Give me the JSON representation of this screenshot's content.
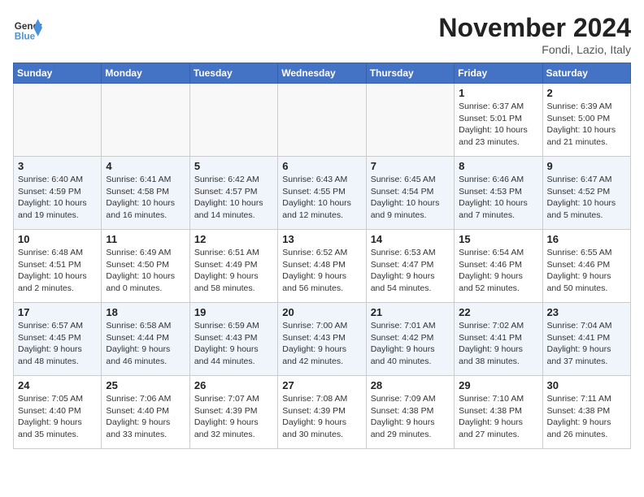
{
  "logo": {
    "line1": "General",
    "line2": "Blue"
  },
  "title": "November 2024",
  "subtitle": "Fondi, Lazio, Italy",
  "weekdays": [
    "Sunday",
    "Monday",
    "Tuesday",
    "Wednesday",
    "Thursday",
    "Friday",
    "Saturday"
  ],
  "weeks": [
    [
      {
        "day": "",
        "info": ""
      },
      {
        "day": "",
        "info": ""
      },
      {
        "day": "",
        "info": ""
      },
      {
        "day": "",
        "info": ""
      },
      {
        "day": "",
        "info": ""
      },
      {
        "day": "1",
        "info": "Sunrise: 6:37 AM\nSunset: 5:01 PM\nDaylight: 10 hours\nand 23 minutes."
      },
      {
        "day": "2",
        "info": "Sunrise: 6:39 AM\nSunset: 5:00 PM\nDaylight: 10 hours\nand 21 minutes."
      }
    ],
    [
      {
        "day": "3",
        "info": "Sunrise: 6:40 AM\nSunset: 4:59 PM\nDaylight: 10 hours\nand 19 minutes."
      },
      {
        "day": "4",
        "info": "Sunrise: 6:41 AM\nSunset: 4:58 PM\nDaylight: 10 hours\nand 16 minutes."
      },
      {
        "day": "5",
        "info": "Sunrise: 6:42 AM\nSunset: 4:57 PM\nDaylight: 10 hours\nand 14 minutes."
      },
      {
        "day": "6",
        "info": "Sunrise: 6:43 AM\nSunset: 4:55 PM\nDaylight: 10 hours\nand 12 minutes."
      },
      {
        "day": "7",
        "info": "Sunrise: 6:45 AM\nSunset: 4:54 PM\nDaylight: 10 hours\nand 9 minutes."
      },
      {
        "day": "8",
        "info": "Sunrise: 6:46 AM\nSunset: 4:53 PM\nDaylight: 10 hours\nand 7 minutes."
      },
      {
        "day": "9",
        "info": "Sunrise: 6:47 AM\nSunset: 4:52 PM\nDaylight: 10 hours\nand 5 minutes."
      }
    ],
    [
      {
        "day": "10",
        "info": "Sunrise: 6:48 AM\nSunset: 4:51 PM\nDaylight: 10 hours\nand 2 minutes."
      },
      {
        "day": "11",
        "info": "Sunrise: 6:49 AM\nSunset: 4:50 PM\nDaylight: 10 hours\nand 0 minutes."
      },
      {
        "day": "12",
        "info": "Sunrise: 6:51 AM\nSunset: 4:49 PM\nDaylight: 9 hours\nand 58 minutes."
      },
      {
        "day": "13",
        "info": "Sunrise: 6:52 AM\nSunset: 4:48 PM\nDaylight: 9 hours\nand 56 minutes."
      },
      {
        "day": "14",
        "info": "Sunrise: 6:53 AM\nSunset: 4:47 PM\nDaylight: 9 hours\nand 54 minutes."
      },
      {
        "day": "15",
        "info": "Sunrise: 6:54 AM\nSunset: 4:46 PM\nDaylight: 9 hours\nand 52 minutes."
      },
      {
        "day": "16",
        "info": "Sunrise: 6:55 AM\nSunset: 4:46 PM\nDaylight: 9 hours\nand 50 minutes."
      }
    ],
    [
      {
        "day": "17",
        "info": "Sunrise: 6:57 AM\nSunset: 4:45 PM\nDaylight: 9 hours\nand 48 minutes."
      },
      {
        "day": "18",
        "info": "Sunrise: 6:58 AM\nSunset: 4:44 PM\nDaylight: 9 hours\nand 46 minutes."
      },
      {
        "day": "19",
        "info": "Sunrise: 6:59 AM\nSunset: 4:43 PM\nDaylight: 9 hours\nand 44 minutes."
      },
      {
        "day": "20",
        "info": "Sunrise: 7:00 AM\nSunset: 4:43 PM\nDaylight: 9 hours\nand 42 minutes."
      },
      {
        "day": "21",
        "info": "Sunrise: 7:01 AM\nSunset: 4:42 PM\nDaylight: 9 hours\nand 40 minutes."
      },
      {
        "day": "22",
        "info": "Sunrise: 7:02 AM\nSunset: 4:41 PM\nDaylight: 9 hours\nand 38 minutes."
      },
      {
        "day": "23",
        "info": "Sunrise: 7:04 AM\nSunset: 4:41 PM\nDaylight: 9 hours\nand 37 minutes."
      }
    ],
    [
      {
        "day": "24",
        "info": "Sunrise: 7:05 AM\nSunset: 4:40 PM\nDaylight: 9 hours\nand 35 minutes."
      },
      {
        "day": "25",
        "info": "Sunrise: 7:06 AM\nSunset: 4:40 PM\nDaylight: 9 hours\nand 33 minutes."
      },
      {
        "day": "26",
        "info": "Sunrise: 7:07 AM\nSunset: 4:39 PM\nDaylight: 9 hours\nand 32 minutes."
      },
      {
        "day": "27",
        "info": "Sunrise: 7:08 AM\nSunset: 4:39 PM\nDaylight: 9 hours\nand 30 minutes."
      },
      {
        "day": "28",
        "info": "Sunrise: 7:09 AM\nSunset: 4:38 PM\nDaylight: 9 hours\nand 29 minutes."
      },
      {
        "day": "29",
        "info": "Sunrise: 7:10 AM\nSunset: 4:38 PM\nDaylight: 9 hours\nand 27 minutes."
      },
      {
        "day": "30",
        "info": "Sunrise: 7:11 AM\nSunset: 4:38 PM\nDaylight: 9 hours\nand 26 minutes."
      }
    ]
  ]
}
